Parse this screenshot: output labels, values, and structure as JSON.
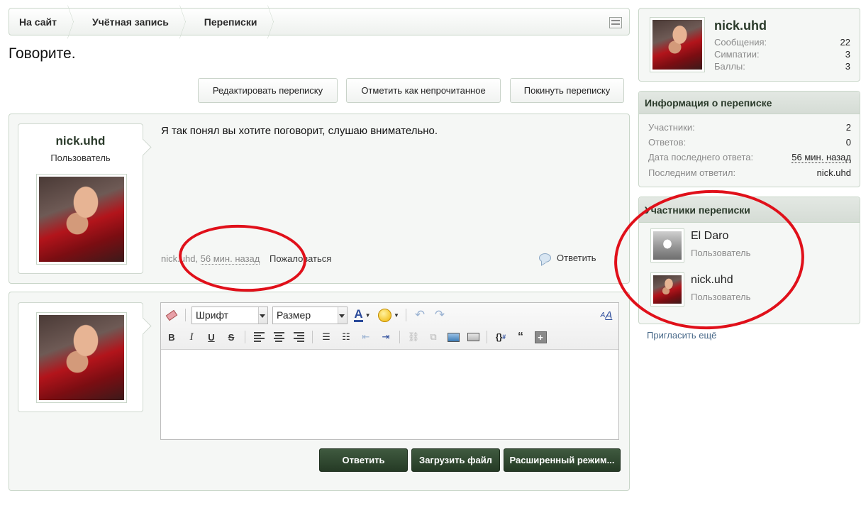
{
  "breadcrumb": {
    "items": [
      "На сайт",
      "Учётная запись",
      "Переписки"
    ]
  },
  "page": {
    "title": "Говорите."
  },
  "actions": {
    "edit": "Редактировать переписку",
    "mark_unread": "Отметить как непрочитанное",
    "leave": "Покинуть переписку"
  },
  "message": {
    "username": "nick.uhd",
    "role": "Пользователь",
    "text": "Я так понял вы хотите поговорит, слушаю внимательно.",
    "author": "nick.uhd",
    "separator": ", ",
    "time": "56 мин. назад",
    "report": "Пожаловаться",
    "reply": "Ответить"
  },
  "editor": {
    "font_label": "Шрифт",
    "size_label": "Размер",
    "reply_button": "Ответить",
    "upload_button": "Загрузить файл",
    "advanced_button": "Расширенный режим..."
  },
  "sidebar": {
    "profile": {
      "username": "nick.uhd",
      "stats": [
        {
          "label": "Сообщения:",
          "value": "22"
        },
        {
          "label": "Симпатии:",
          "value": "3"
        },
        {
          "label": "Баллы:",
          "value": "3"
        }
      ]
    },
    "info": {
      "title": "Информация о переписке",
      "rows": [
        {
          "label": "Участники:",
          "value": "2"
        },
        {
          "label": "Ответов:",
          "value": "0"
        },
        {
          "label": "Дата последнего ответа:",
          "value": "56 мин. назад"
        },
        {
          "label": "Последним ответил:",
          "value": "nick.uhd"
        }
      ]
    },
    "participants": {
      "title": "Участники переписки",
      "items": [
        {
          "name": "El Daro",
          "role": "Пользователь"
        },
        {
          "name": "nick.uhd",
          "role": "Пользователь"
        }
      ],
      "invite": "Пригласить ещё"
    }
  },
  "colors": {
    "annotation": "#e0101a",
    "dark_button": "#2f472f",
    "border": "#c9d6c9"
  }
}
